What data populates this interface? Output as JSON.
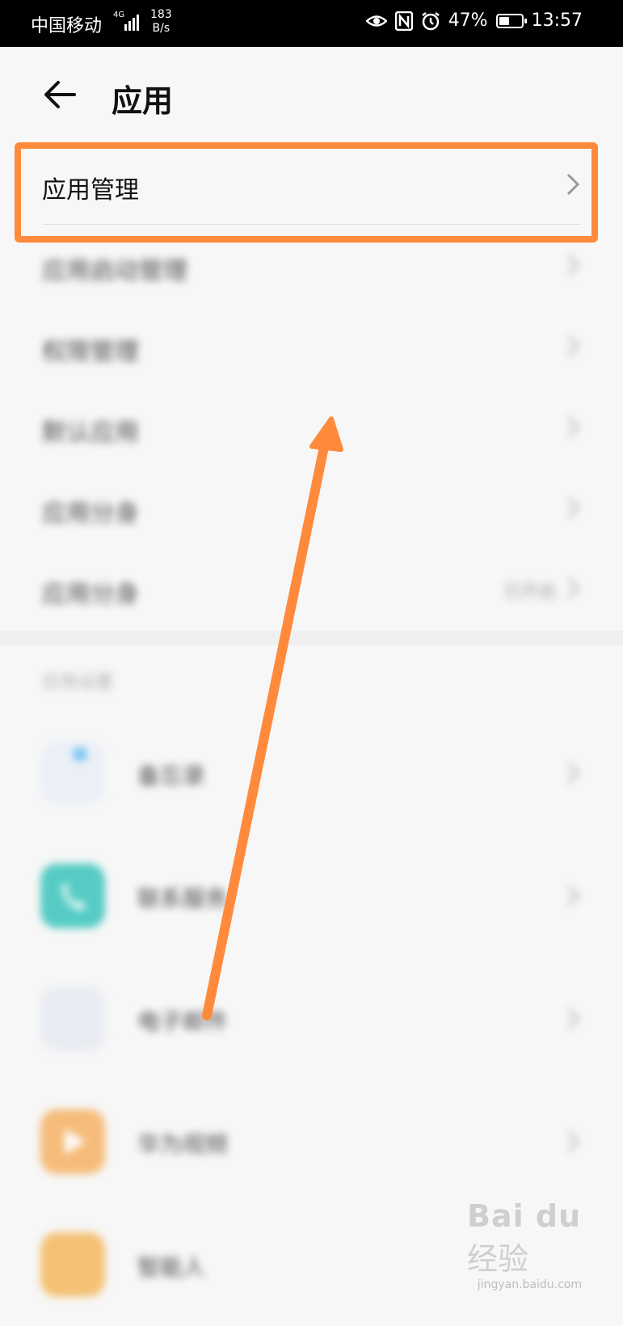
{
  "status_bar": {
    "carrier": "中国移动",
    "network": "4G",
    "speed_value": "183",
    "speed_unit": "B/s",
    "battery_percent_text": "47%",
    "battery_level": 0.47,
    "time": "13:57",
    "icons": [
      "eye-comfort-icon",
      "nfc-icon",
      "alarm-icon",
      "battery-icon",
      "signal-icon"
    ]
  },
  "header": {
    "title": "应用",
    "back_icon": "arrow-left-icon"
  },
  "settings_list": [
    {
      "label": "应用管理",
      "value": ""
    },
    {
      "label": "应用启动管理",
      "value": ""
    },
    {
      "label": "权限管理",
      "value": ""
    },
    {
      "label": "默认应用",
      "value": ""
    },
    {
      "label": "应用分身",
      "value": ""
    },
    {
      "label": "应用分身",
      "value": "已开启"
    }
  ],
  "section": {
    "title": "应用设置"
  },
  "apps": [
    {
      "name": "备忘录",
      "icon_color": "#e8eef6",
      "icon": "memo-icon"
    },
    {
      "name": "联系服务",
      "icon_color": "#20bdb4",
      "icon": "phone-icon"
    },
    {
      "name": "电子邮件",
      "icon_color": "#e4e8ef",
      "icon": "email-icon"
    },
    {
      "name": "华为视频",
      "icon_color": "#f6a84e",
      "icon": "video-icon"
    },
    {
      "name": "智能人",
      "icon_color": "#f3b04a",
      "icon": "assistant-icon"
    }
  ],
  "annotation": {
    "highlight_color": "#ff8a3c"
  },
  "watermark": {
    "logo": "Bai du",
    "text": "经验",
    "url": "jingyan.baidu.com"
  }
}
